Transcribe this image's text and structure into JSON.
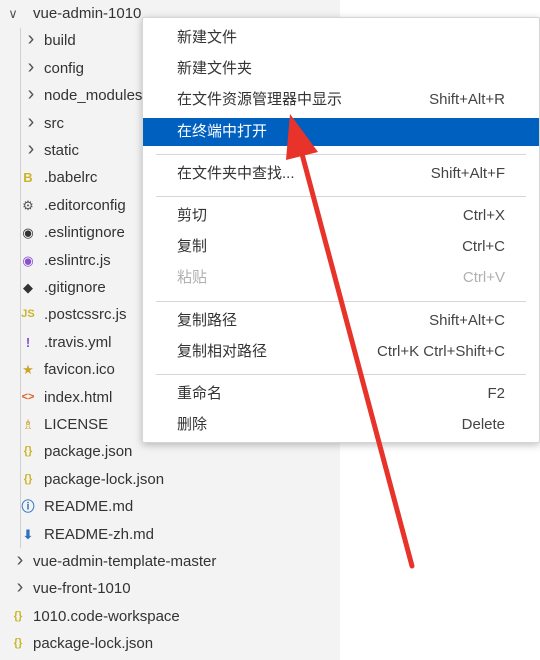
{
  "explorer": {
    "root": "vue-admin-1010",
    "folders": [
      "build",
      "config",
      "node_modules",
      "src",
      "static"
    ],
    "files": [
      {
        "name": ".babelrc",
        "icon": "babel-icon",
        "glyph": "B",
        "color": "#c9b52a"
      },
      {
        "name": ".editorconfig",
        "icon": "gear-icon",
        "glyph": "⚙",
        "color": "#555555"
      },
      {
        "name": ".eslintignore",
        "icon": "eslint-icon",
        "glyph": "◉",
        "color": "#333333"
      },
      {
        "name": ".eslintrc.js",
        "icon": "eslint-icon",
        "glyph": "◉",
        "color": "#8a4fcf"
      },
      {
        "name": ".gitignore",
        "icon": "git-icon",
        "glyph": "◆",
        "color": "#333333"
      },
      {
        "name": ".postcssrc.js",
        "icon": "js-icon",
        "glyph": "JS",
        "color": "#c9b52a"
      },
      {
        "name": ".travis.yml",
        "icon": "yaml-icon",
        "glyph": "!",
        "color": "#8a4fcf"
      },
      {
        "name": "favicon.ico",
        "icon": "star-icon",
        "glyph": "★",
        "color": "#c9a52a"
      },
      {
        "name": "index.html",
        "icon": "html-icon",
        "glyph": "<>",
        "color": "#e06020"
      },
      {
        "name": "LICENSE",
        "icon": "license-icon",
        "glyph": "♗",
        "color": "#c9a52a"
      },
      {
        "name": "package.json",
        "icon": "json-icon",
        "glyph": "{}",
        "color": "#c9b52a"
      },
      {
        "name": "package-lock.json",
        "icon": "json-icon",
        "glyph": "{}",
        "color": "#c9b52a"
      },
      {
        "name": "README.md",
        "icon": "info-icon",
        "glyph": "ⓘ",
        "color": "#3070c0"
      },
      {
        "name": "README-zh.md",
        "icon": "download-icon",
        "glyph": "⬇",
        "color": "#3070c0"
      }
    ],
    "siblings": [
      {
        "name": "vue-admin-template-master",
        "kind": "folder"
      },
      {
        "name": "vue-front-1010",
        "kind": "folder"
      },
      {
        "name": "1010.code-workspace",
        "kind": "file",
        "glyph": "{}",
        "color": "#c9b52a"
      },
      {
        "name": "package-lock.json",
        "kind": "file",
        "glyph": "{}",
        "color": "#c9b52a"
      }
    ]
  },
  "context_menu": {
    "groups": [
      [
        {
          "label": "新建文件",
          "shortcut": ""
        },
        {
          "label": "新建文件夹",
          "shortcut": ""
        },
        {
          "label": "在文件资源管理器中显示",
          "shortcut": "Shift+Alt+R"
        },
        {
          "label": "在终端中打开",
          "shortcut": "",
          "active": true
        }
      ],
      [
        {
          "label": "在文件夹中查找...",
          "shortcut": "Shift+Alt+F"
        }
      ],
      [
        {
          "label": "剪切",
          "shortcut": "Ctrl+X"
        },
        {
          "label": "复制",
          "shortcut": "Ctrl+C"
        },
        {
          "label": "粘贴",
          "shortcut": "Ctrl+V",
          "disabled": true
        }
      ],
      [
        {
          "label": "复制路径",
          "shortcut": "Shift+Alt+C"
        },
        {
          "label": "复制相对路径",
          "shortcut": "Ctrl+K Ctrl+Shift+C"
        }
      ],
      [
        {
          "label": "重命名",
          "shortcut": "F2"
        },
        {
          "label": "删除",
          "shortcut": "Delete"
        }
      ]
    ]
  },
  "colors": {
    "menu_highlight": "#0060c0",
    "annotation_arrow": "#e8332b"
  }
}
